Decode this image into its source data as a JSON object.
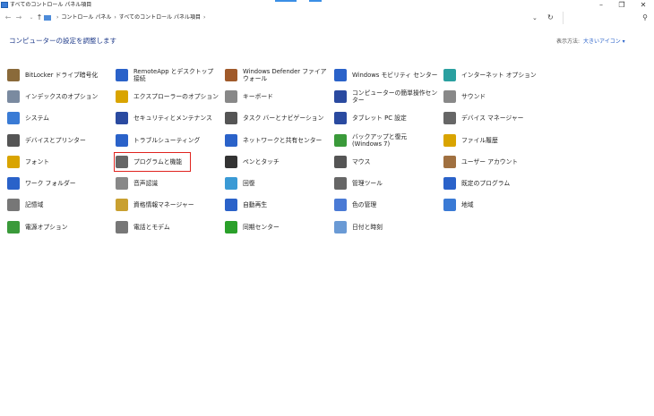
{
  "window": {
    "title": "すべてのコントロール パネル項目"
  },
  "nav": {
    "breadcrumb": [
      "コントロール パネル",
      "すべてのコントロール パネル項目"
    ]
  },
  "header": {
    "title": "コンピューターの設定を調整します",
    "view_by_label": "表示方法:",
    "view_by_value": "大きいアイコン ▾"
  },
  "columns": [
    [
      "BitLocker ドライブ暗号化",
      "インデックスのオプション",
      "システム",
      "デバイスとプリンター",
      "フォント",
      "ワーク フォルダー",
      "記憶域",
      "電源オプション"
    ],
    [
      "RemoteApp とデスクトップ接続",
      "エクスプローラーのオプション",
      "セキュリティとメンテナンス",
      "トラブルシューティング",
      "プログラムと機能",
      "音声認識",
      "資格情報マネージャー",
      "電話とモデム"
    ],
    [
      "Windows Defender ファイアウォール",
      "キーボード",
      "タスク バーとナビゲーション",
      "ネットワークと共有センター",
      "ペンとタッチ",
      "回復",
      "自動再生",
      "同期センター"
    ],
    [
      "Windows モビリティ センター",
      "コンピューターの簡単操作センター",
      "タブレット PC 設定",
      "バックアップと復元 (Windows 7)",
      "マウス",
      "管理ツール",
      "色の管理",
      "日付と時刻"
    ],
    [
      "インターネット オプション",
      "サウンド",
      "デバイス マネージャー",
      "ファイル履歴",
      "ユーザー アカウント",
      "既定のプログラム",
      "地域"
    ]
  ],
  "icon_colors": {
    "c0": [
      "#8a6a3a",
      "#7a8aa0",
      "#3a7bd5",
      "#555",
      "#d9a400",
      "#2a62c9",
      "#777",
      "#3a9a3a"
    ],
    "c1": [
      "#2a62c9",
      "#d9a400",
      "#2a4aa0",
      "#2a62c9",
      "#666",
      "#888",
      "#c9a030",
      "#777"
    ],
    "c2": [
      "#a05a2a",
      "#888",
      "#555",
      "#2a62c9",
      "#333",
      "#3a9ad5",
      "#2a62c9",
      "#2aa02a"
    ],
    "c3": [
      "#2a62c9",
      "#2a4aa0",
      "#2a4aa0",
      "#3a9a3a",
      "#555",
      "#666",
      "#4a7ad5",
      "#6a9ad5"
    ],
    "c4": [
      "#2aa0a0",
      "#888",
      "#666",
      "#d9a400",
      "#a07040",
      "#2a62c9",
      "#3a7ad5"
    ]
  }
}
